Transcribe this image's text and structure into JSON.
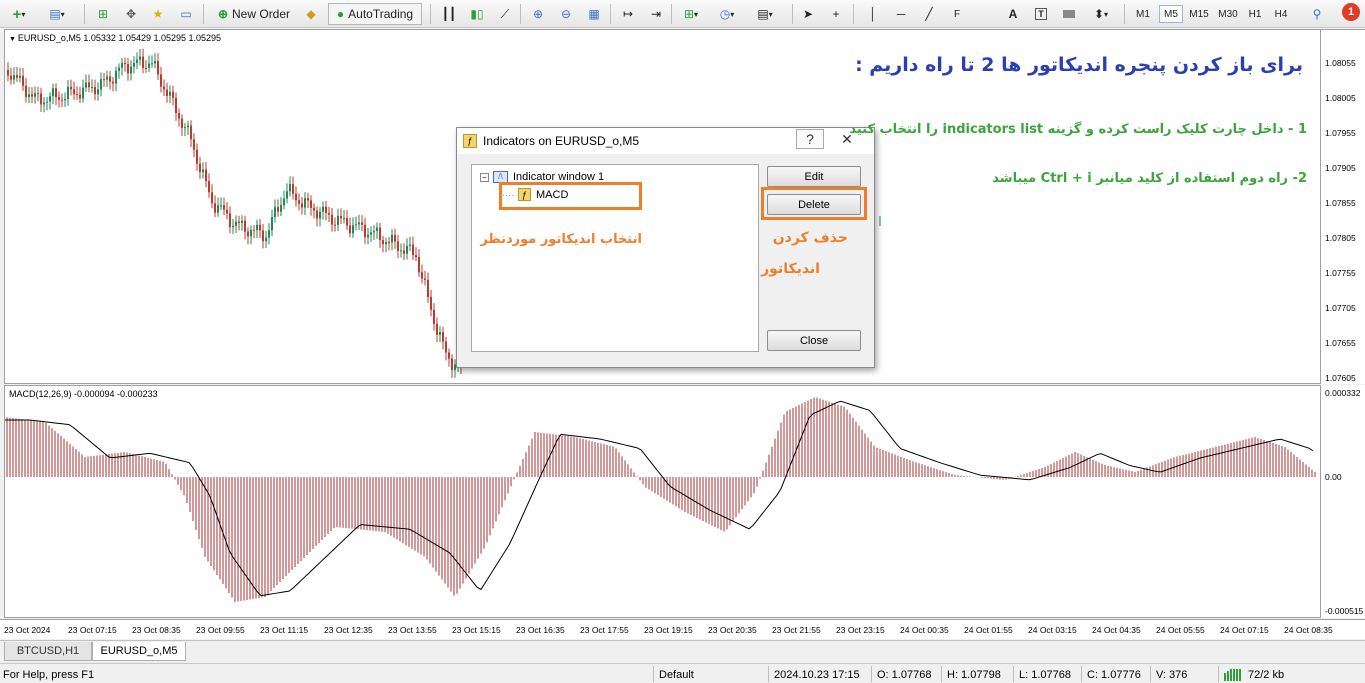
{
  "toolbar": {
    "new_order": "New Order",
    "auto_trading": "AutoTrading",
    "timeframes": [
      "M1",
      "M5",
      "M15",
      "M30",
      "H1",
      "H4"
    ],
    "active_timeframe": "M5",
    "notification_count": "1"
  },
  "chart": {
    "symbol_info": "EURUSD_o,M5  1.05332 1.05429 1.05295 1.05295",
    "bull_color": "#1f8a55",
    "bear_color": "#c0392b",
    "price_labels": [
      "1.08055",
      "1.08005",
      "1.07955",
      "1.07905",
      "1.07855",
      "1.07805",
      "1.07755",
      "1.07705",
      "1.07655",
      "1.07605"
    ]
  },
  "macd": {
    "label": "MACD(12,26,9) -0.000094 -0.000233",
    "axis_labels": [
      "0.000332",
      "0.00",
      "-0.000515"
    ]
  },
  "time_labels": [
    "23 Oct 2024",
    "23 Oct 07:15",
    "23 Oct 08:35",
    "23 Oct 09:55",
    "23 Oct 11:15",
    "23 Oct 12:35",
    "23 Oct 13:55",
    "23 Oct 15:15",
    "23 Oct 16:35",
    "23 Oct 17:55",
    "23 Oct 19:15",
    "23 Oct 20:35",
    "23 Oct 21:55",
    "23 Oct 23:15",
    "24 Oct 00:35",
    "24 Oct 01:55",
    "24 Oct 03:15",
    "24 Oct 04:35",
    "24 Oct 05:55",
    "24 Oct 07:15",
    "24 Oct 08:35"
  ],
  "tabs": [
    "BTCUSD,H1",
    "EURUSD_o,M5"
  ],
  "active_tab": "EURUSD_o,M5",
  "status": {
    "help": "For Help, press F1",
    "profile": "Default",
    "datetime": "2024.10.23 17:15",
    "open": "O: 1.07768",
    "high": "H: 1.07798",
    "low": "L: 1.07768",
    "close": "C: 1.07776",
    "volume": "V: 376",
    "traffic": "72/2 kb"
  },
  "dialog": {
    "title": "Indicators on EURUSD_o,M5",
    "help_glyph": "?",
    "tree_window": "Indicator window 1",
    "tree_item": "MACD",
    "edit": "Edit",
    "delete": "Delete",
    "close": "Close"
  },
  "annotations": {
    "heading": "برای باز کردن پنجره اندیکاتور ها 2 تا راه داریم :",
    "step1": "1 - داخل چارت کلیک راست کرده و گزینه indicators list را انتخاب کنید",
    "step2": "2- راه دوم استفاده از کلید میانبر Ctrl + i میباشد",
    "select_note": "انتخاب اندیکاتور موردنظر",
    "delete_note_line1": "حذف کردن",
    "delete_note_line2": "اندیکاتور",
    "heading_color": "#2b3fb5",
    "step_color": "#3aa53a",
    "accent_color": "#ee7e2a"
  }
}
